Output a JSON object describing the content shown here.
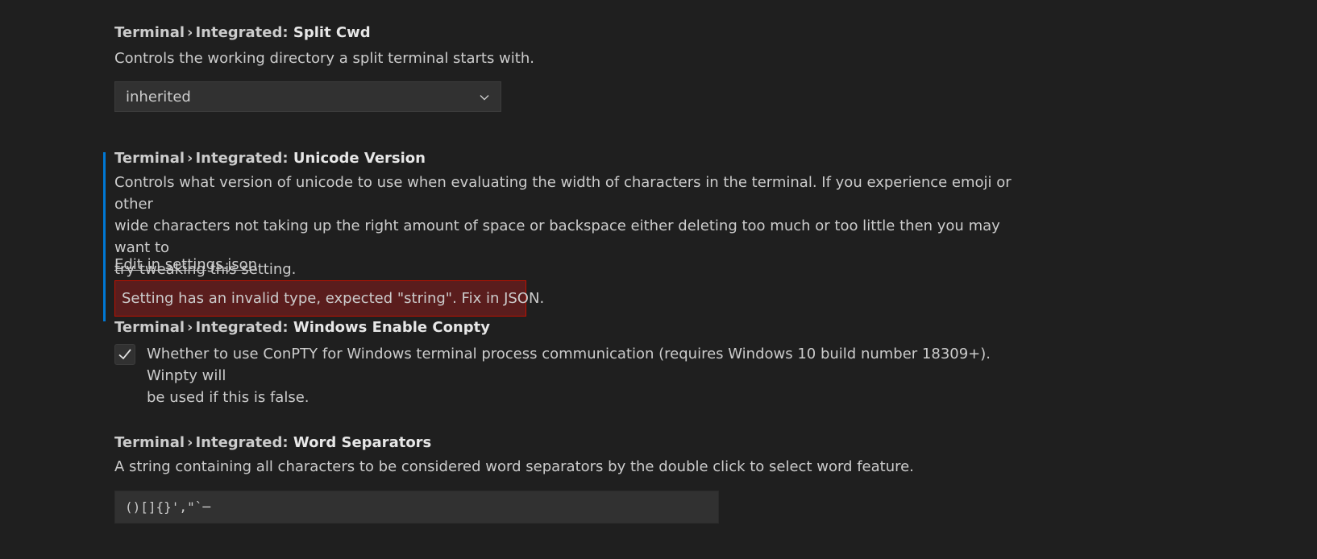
{
  "settings": {
    "split_cwd": {
      "category": "Terminal",
      "separator": "›",
      "subcategory": "Integrated:",
      "label": "Split Cwd",
      "description": "Controls the working directory a split terminal starts with.",
      "value": "inherited"
    },
    "unicode_version": {
      "category": "Terminal",
      "separator": "›",
      "subcategory": "Integrated:",
      "label": "Unicode Version",
      "description_line1": "Controls what version of unicode to use when evaluating the width of characters in the terminal. If you experience emoji or other",
      "description_line2": "wide characters not taking up the right amount of space or backspace either deleting too much or too little then you may want to",
      "description_line3": "try tweaking this setting.",
      "edit_link": "Edit in settings.json",
      "error": "Setting has an invalid type, expected \"string\". Fix in JSON."
    },
    "windows_enable_conpty": {
      "category": "Terminal",
      "separator": "›",
      "subcategory": "Integrated:",
      "label": "Windows Enable Conpty",
      "description_line1": "Whether to use ConPTY for Windows terminal process communication (requires Windows 10 build number 18309+). Winpty will",
      "description_line2": "be used if this is false.",
      "checked": true
    },
    "word_separators": {
      "category": "Terminal",
      "separator": "›",
      "subcategory": "Integrated:",
      "label": "Word Separators",
      "description": "A string containing all characters to be considered word separators by the double click to select word feature.",
      "value": "()[]{}',\"`─"
    }
  },
  "colors": {
    "background": "#1f1f1f",
    "focus_bar": "#0078d4",
    "error_border": "#be1100",
    "error_background": "#5a1d1d",
    "input_background": "#313131"
  }
}
